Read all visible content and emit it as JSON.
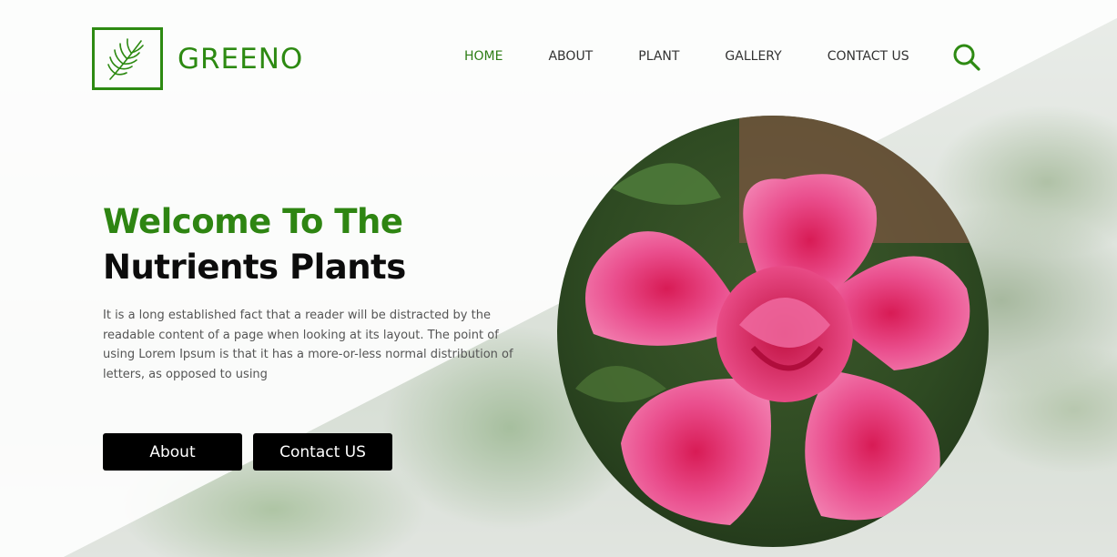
{
  "brand": {
    "name": "GREENO",
    "logo_icon": "palm-leaf-icon",
    "color": "#2d8a12"
  },
  "nav": {
    "items": [
      {
        "label": "HOME",
        "active": true
      },
      {
        "label": "ABOUT",
        "active": false
      },
      {
        "label": "PLANT",
        "active": false
      },
      {
        "label": "GALLERY",
        "active": false
      },
      {
        "label": "CONTACT US",
        "active": false
      }
    ],
    "search_icon": "search-icon"
  },
  "hero": {
    "title_line1": "Welcome To The",
    "title_line2": "Nutrients Plants",
    "description": "It is a long established fact that a reader will be distracted by the readable content of a page when looking at its layout. The point of using Lorem Ipsum is that it has a more-or-less normal distribution of letters, as opposed to using",
    "buttons": {
      "about": "About",
      "contact": "Contact US"
    },
    "image": "pink-flower-image"
  },
  "colors": {
    "accent": "#2d8a12",
    "button_bg": "#000000",
    "flower": "#e0407f"
  }
}
